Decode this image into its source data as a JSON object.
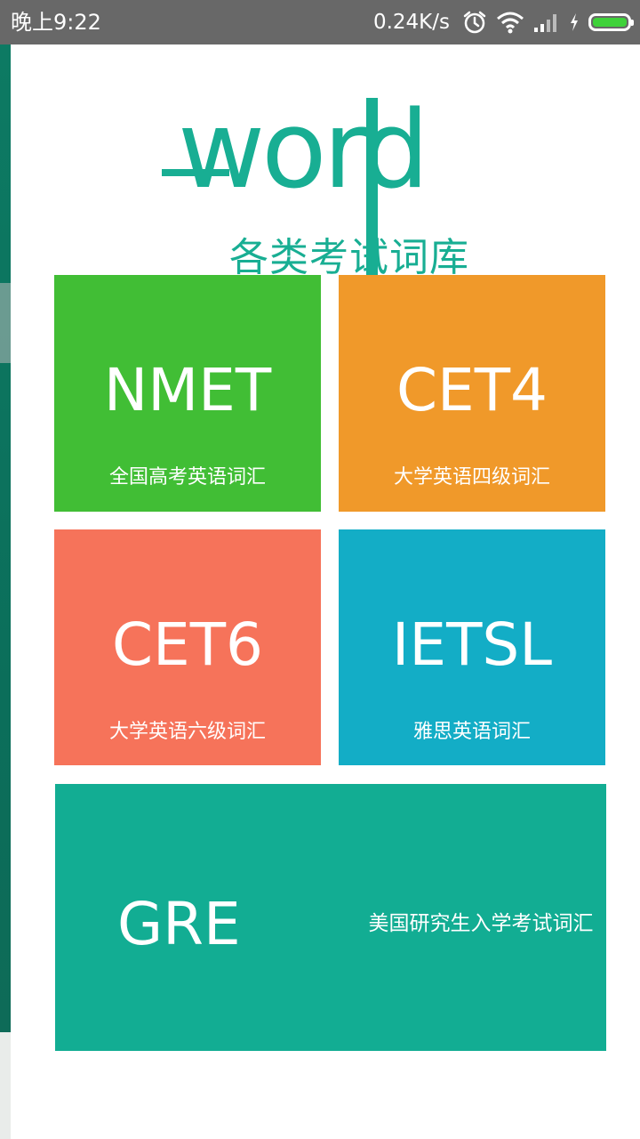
{
  "status_bar": {
    "time": "晚上9:22",
    "net_speed": "0.24K/s",
    "icons": [
      "alarm-icon",
      "wifi-icon",
      "signal-icon",
      "charging-icon",
      "battery-icon"
    ],
    "battery_color": "#3fd23a"
  },
  "logo": {
    "word": "word",
    "subtitle": "各类考试词库",
    "color": "#18ae93"
  },
  "tiles": [
    {
      "title": "NMET",
      "subtitle": "全国高考英语词汇",
      "color": "#41be35"
    },
    {
      "title": "CET4",
      "subtitle": "大学英语四级词汇",
      "color": "#f0992a"
    },
    {
      "title": "CET6",
      "subtitle": "大学英语六级词汇",
      "color": "#f6735a"
    },
    {
      "title": "IETSL",
      "subtitle": "雅思英语词汇",
      "color": "#13adc6"
    },
    {
      "title": "GRE",
      "subtitle": "美国研究生入学考试词汇",
      "color": "#12ad93"
    }
  ]
}
